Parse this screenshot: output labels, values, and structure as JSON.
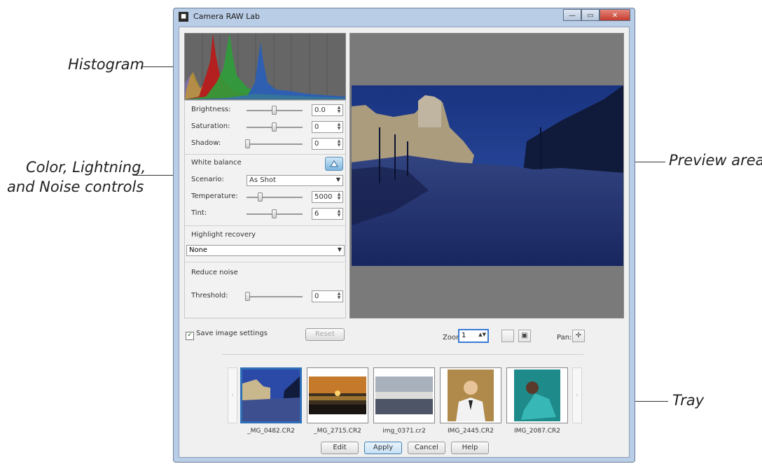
{
  "callouts": {
    "histogram": "Histogram",
    "controls_line1": "Color, Lightning,",
    "controls_line2": "and Noise controls",
    "preview": "Preview area",
    "tray": "Tray"
  },
  "window": {
    "title": "Camera RAW Lab",
    "buttons": {
      "minimize": "—",
      "maximize": "▭",
      "close": "✕"
    }
  },
  "adjustments": {
    "brightness": {
      "label": "Brightness:",
      "value": "0.0",
      "slider_fraction": 0.5
    },
    "saturation": {
      "label": "Saturation:",
      "value": "0",
      "slider_fraction": 0.5
    },
    "shadow": {
      "label": "Shadow:",
      "value": "0",
      "slider_fraction": 0.0
    }
  },
  "white_balance": {
    "label": "White balance",
    "scenario_label": "Scenario:",
    "scenario_value": "As Shot",
    "temperature": {
      "label": "Temperature:",
      "value": "5000",
      "slider_fraction": 0.25
    },
    "tint": {
      "label": "Tint:",
      "value": "6",
      "slider_fraction": 0.5
    }
  },
  "highlight_recovery": {
    "label": "Highlight recovery",
    "value": "None"
  },
  "reduce_noise": {
    "label": "Reduce noise",
    "threshold": {
      "label": "Threshold:",
      "value": "0",
      "slider_fraction": 0.0
    }
  },
  "save_settings": {
    "label": "Save image settings",
    "checked": true
  },
  "reset_label": "Reset",
  "zoom": {
    "label": "Zoom:",
    "value": "1"
  },
  "pan_label": "Pan:",
  "tray": {
    "items": [
      {
        "name": "_MG_0482.CR2",
        "selected": true
      },
      {
        "name": "_MG_2715.CR2",
        "selected": false
      },
      {
        "name": "img_0371.cr2",
        "selected": false
      },
      {
        "name": "IMG_2445.CR2",
        "selected": false
      },
      {
        "name": "IMG_2087.CR2",
        "selected": false
      }
    ],
    "left_arrow": "‹",
    "right_arrow": "›"
  },
  "buttons": {
    "edit": "Edit",
    "apply": "Apply",
    "cancel": "Cancel",
    "help": "Help"
  },
  "colors": {
    "accent": "#2f6fb7",
    "preview_bg": "#7a7a7a",
    "histogram_bg": "#666666"
  }
}
